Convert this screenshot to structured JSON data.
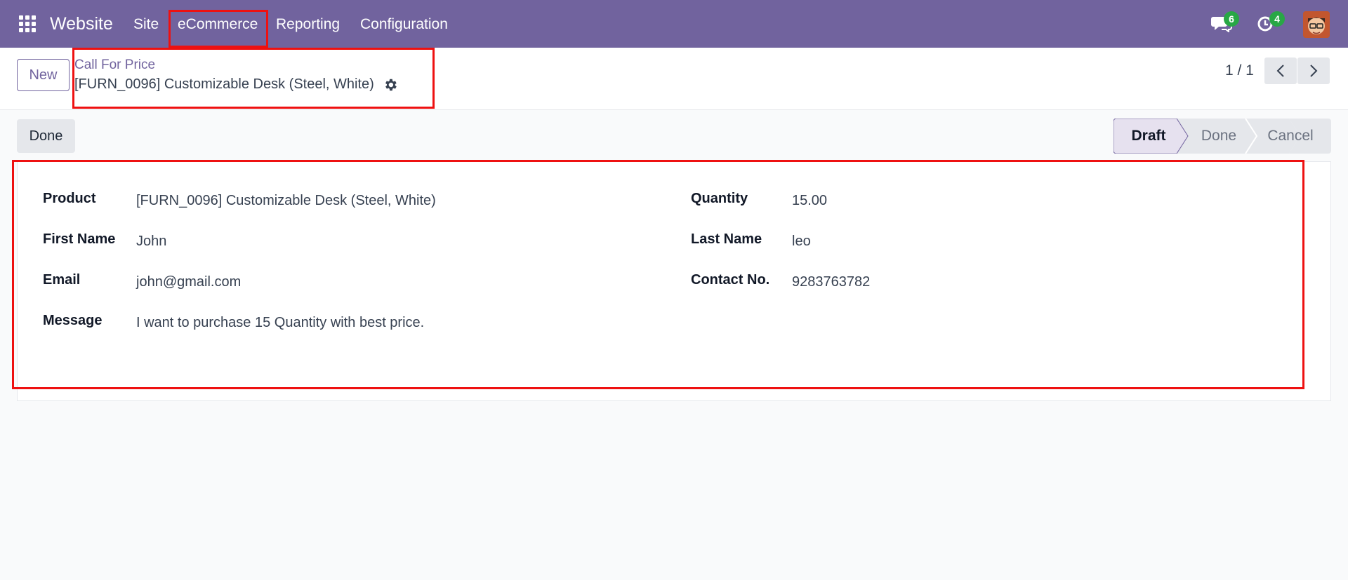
{
  "navbar": {
    "brand": "Website",
    "menu": {
      "site": "Site",
      "ecommerce": "eCommerce",
      "reporting": "Reporting",
      "configuration": "Configuration"
    },
    "chat_count": "6",
    "activity_count": "4",
    "color": "#71639e"
  },
  "control_panel": {
    "new_label": "New",
    "breadcrumb": "Call For Price",
    "record_title": "[FURN_0096] Customizable Desk (Steel, White)",
    "pager": "1 / 1"
  },
  "statusbar": {
    "done_button": "Done",
    "stages": [
      "Draft",
      "Done",
      "Cancel"
    ],
    "active_stage": "Draft"
  },
  "form": {
    "left": [
      {
        "label": "Product",
        "value": "[FURN_0096] Customizable Desk (Steel, White)"
      },
      {
        "label": "First Name",
        "value": "John"
      },
      {
        "label": "Email",
        "value": "john@gmail.com"
      },
      {
        "label": "Message",
        "value": "I want to purchase 15 Quantity with best price."
      }
    ],
    "right": [
      {
        "label": "Quantity",
        "value": "15.00"
      },
      {
        "label": "Last Name",
        "value": "leo"
      },
      {
        "label": "Contact No.",
        "value": "9283763782"
      }
    ]
  }
}
